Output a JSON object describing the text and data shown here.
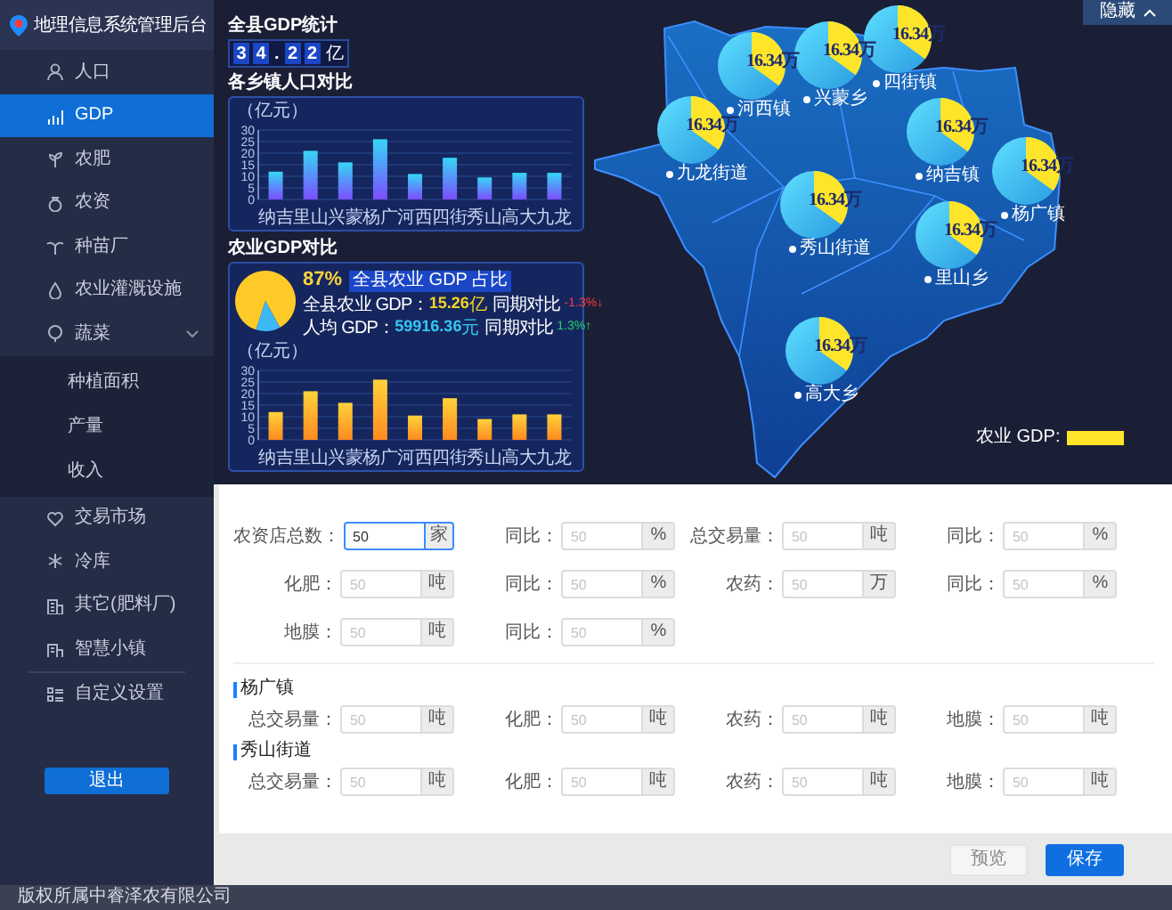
{
  "sidebar": {
    "title": "地理信息系统管理后台",
    "items": [
      {
        "label": "人口",
        "selected": false
      },
      {
        "label": "GDP",
        "selected": true
      },
      {
        "label": "农肥",
        "selected": false
      },
      {
        "label": "农资",
        "selected": false
      },
      {
        "label": "种苗厂",
        "selected": false
      },
      {
        "label": "农业灌溉设施",
        "selected": false
      },
      {
        "label": "蔬菜",
        "selected": false,
        "expanded": true,
        "children": [
          {
            "label": "种植面积",
            "selected": false
          },
          {
            "label": "产量",
            "selected": false
          },
          {
            "label": "收入",
            "selected": false
          }
        ]
      },
      {
        "label": "交易市场",
        "selected": false
      },
      {
        "label": "冷库",
        "selected": false
      },
      {
        "label": "其它(肥料厂)",
        "selected": false
      },
      {
        "label": "智慧小镇",
        "selected": false
      },
      {
        "label": "自定义设置",
        "selected": false
      }
    ],
    "logout": "退出"
  },
  "gdp_total": {
    "title": "全县GDP统计",
    "chars": [
      {
        "text": "3",
        "kind": "digit"
      },
      {
        "text": "4",
        "kind": "digit"
      },
      {
        "text": ".",
        "kind": "separator"
      },
      {
        "text": "2",
        "kind": "digit"
      },
      {
        "text": "2",
        "kind": "digit"
      },
      {
        "text": "亿",
        "kind": "unit"
      }
    ]
  },
  "population_chart": {
    "title": "各乡镇人口对比",
    "chart_data": {
      "type": "bar",
      "ylabel": "（亿元）",
      "categories": [
        "纳吉",
        "里山",
        "兴蒙",
        "杨广",
        "河西",
        "四街",
        "秀山",
        "高大",
        "九龙"
      ],
      "series": [
        {
          "color": "#36d6f5",
          "values": [
            12,
            21,
            16,
            26,
            11,
            18,
            9.5,
            11.5,
            11.5
          ]
        }
      ],
      "ylim": [
        0,
        30
      ],
      "yticks": [
        0,
        5,
        10,
        15,
        20,
        25,
        30
      ],
      "grid": true
    }
  },
  "agri_gdp": {
    "title": "农业GDP对比",
    "share": {
      "text": "87%",
      "badge": "全县农业 GDP 占比",
      "chart_data": {
        "type": "pie",
        "values": [
          87,
          13
        ]
      }
    },
    "stats": [
      {
        "label": "全县农业 GDP：",
        "value": "15.26",
        "unit": "亿",
        "color": "#f5d327",
        "compare_label": "同期对比",
        "change": {
          "text": "-1.3%↓",
          "color": "#ff3b3b"
        }
      },
      {
        "label": "人均 GDP：",
        "value": "59916.36",
        "unit": "元",
        "color": "#35c8f5",
        "compare_label": "同期对比",
        "change": {
          "text": "1.3%↑",
          "color": "#21d46b"
        }
      }
    ],
    "chart_data": {
      "type": "bar",
      "ylabel": "（亿元）",
      "categories": [
        "纳吉",
        "里山",
        "兴蒙",
        "杨广",
        "河西",
        "四街",
        "秀山",
        "高大",
        "九龙"
      ],
      "series": [
        {
          "color": "#ffd23a",
          "values": [
            12,
            21,
            16,
            26,
            10.5,
            18,
            9,
            11,
            11
          ]
        }
      ],
      "ylim": [
        0,
        30
      ],
      "yticks": [
        0,
        5,
        10,
        15,
        20,
        25,
        30
      ],
      "grid": true
    }
  },
  "map": {
    "hide_button": "隐藏",
    "markers": [
      {
        "name": "四街镇",
        "value": "16.34万"
      },
      {
        "name": "兴蒙乡",
        "value": "16.34万"
      },
      {
        "name": "河西镇",
        "value": "16.34万"
      },
      {
        "name": "九龙街道",
        "value": "16.34万"
      },
      {
        "name": "纳吉镇",
        "value": "16.34万"
      },
      {
        "name": "杨广镇",
        "value": "16.34万"
      },
      {
        "name": "秀山街道",
        "value": "16.34万"
      },
      {
        "name": "里山乡",
        "value": "16.34万"
      },
      {
        "name": "高大乡",
        "value": "16.34万"
      }
    ],
    "legend": {
      "label": "农业 GDP:"
    }
  },
  "form": {
    "rows": [
      [
        {
          "label": "农资店总数：",
          "value": "50",
          "unit": "家",
          "focused": true
        },
        {
          "label": "同比：",
          "placeholder": "50",
          "unit": "%",
          "focused": false
        },
        {
          "label": "总交易量：",
          "placeholder": "50",
          "unit": "吨",
          "focused": false
        },
        {
          "label": "同比：",
          "placeholder": "50",
          "unit": "%",
          "focused": false
        }
      ],
      [
        {
          "label": "化肥：",
          "placeholder": "50",
          "unit": "吨",
          "focused": false
        },
        {
          "label": "同比：",
          "placeholder": "50",
          "unit": "%",
          "focused": false
        },
        {
          "label": "农药：",
          "placeholder": "50",
          "unit": "万",
          "focused": false
        },
        {
          "label": "同比：",
          "placeholder": "50",
          "unit": "%",
          "focused": false
        }
      ],
      [
        {
          "label": "地膜：",
          "placeholder": "50",
          "unit": "吨",
          "focused": false
        },
        {
          "label": "同比：",
          "placeholder": "50",
          "unit": "%",
          "focused": false
        }
      ]
    ],
    "sections": [
      {
        "title": "杨广镇",
        "fields": [
          {
            "label": "总交易量：",
            "placeholder": "50",
            "unit": "吨",
            "focused": false
          },
          {
            "label": "化肥：",
            "placeholder": "50",
            "unit": "吨",
            "focused": false
          },
          {
            "label": "农药：",
            "placeholder": "50",
            "unit": "吨",
            "focused": false
          },
          {
            "label": "地膜：",
            "placeholder": "50",
            "unit": "吨",
            "focused": false
          }
        ]
      },
      {
        "title": "秀山街道",
        "fields": [
          {
            "label": "总交易量：",
            "placeholder": "50",
            "unit": "吨",
            "focused": false
          },
          {
            "label": "化肥：",
            "placeholder": "50",
            "unit": "吨",
            "focused": false
          },
          {
            "label": "农药：",
            "placeholder": "50",
            "unit": "吨",
            "focused": false
          },
          {
            "label": "地膜：",
            "placeholder": "50",
            "unit": "吨",
            "focused": false
          }
        ]
      }
    ],
    "buttons": [
      {
        "label": "预览",
        "kind": "secondary"
      },
      {
        "label": "保存",
        "kind": "primary"
      }
    ]
  },
  "footer": "版权所属中睿泽农有限公司"
}
